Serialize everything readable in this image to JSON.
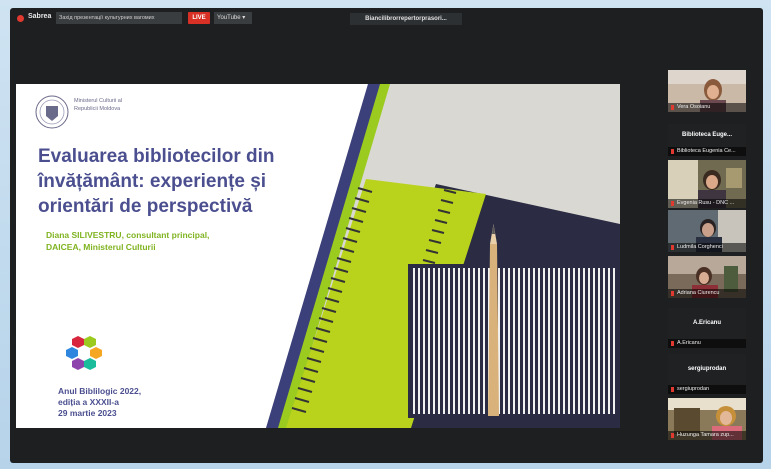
{
  "topbar": {
    "recording_label": "Sabrea",
    "description": "Захід презентації культурних вагомих",
    "live_badge": "LIVE",
    "platform": "YouTube ▾",
    "window_title": "Biancilibrorrepertorprasori..."
  },
  "slide": {
    "logo_text": "Ministerul Culturii al Republicii Moldova",
    "title": "Evaluarea bibliotecilor din învățământ: experiențe și orientări de perspectivă",
    "author_line1": "Diana SILIVESTRU, consultant principal,",
    "author_line2": "DAICEA, Ministerul Culturii",
    "event_line1": "Anul Biblilogic 2022,",
    "event_line2": "ediția a XXXII-a",
    "event_line3": "29 martie 2023"
  },
  "participants": [
    {
      "name": "Vera Osoianu",
      "center": ""
    },
    {
      "name": "Biblioteca Eugenia Ce...",
      "center": "Biblioteca Euge..."
    },
    {
      "name": "Evgenia Rusu - DNC ...",
      "center": ""
    },
    {
      "name": "Ludmila Corghenci",
      "center": ""
    },
    {
      "name": "Adriana Ciurencu",
      "center": ""
    },
    {
      "name": "A.Ericanu",
      "center": "A.Ericanu"
    },
    {
      "name": "sergiuprodan",
      "center": "sergiuprodan"
    },
    {
      "name": "Huzunga Tamara zup...",
      "center": ""
    }
  ],
  "colors": {
    "accent_red": "#e0392f",
    "slide_title": "#4b4f8f",
    "slide_author": "#7fb320"
  }
}
